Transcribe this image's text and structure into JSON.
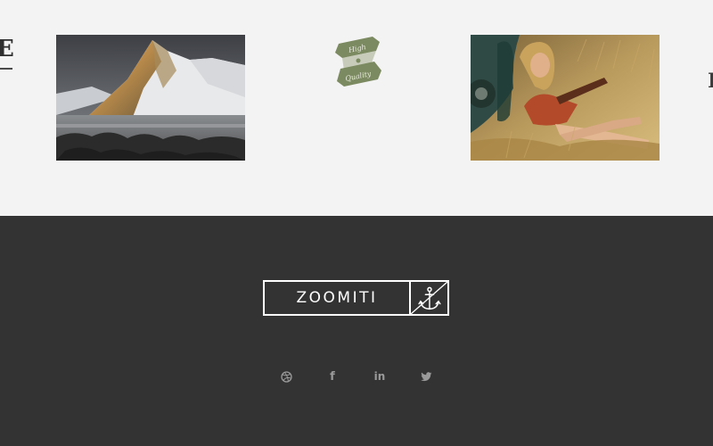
{
  "gallery": {
    "left_fragment": "E",
    "right_fragment": "I",
    "badge_line1": "High",
    "badge_line2": "Quality",
    "badge_color": "#7c8a61"
  },
  "footer": {
    "background": "#333333",
    "logo_text": "ZOOMITI",
    "logo_icon": "anchor-icon",
    "social": [
      {
        "name": "dribbble-icon",
        "glyph": "⚽"
      },
      {
        "name": "facebook-icon",
        "glyph": "f"
      },
      {
        "name": "linkedin-icon",
        "glyph": "in"
      },
      {
        "name": "twitter-icon",
        "glyph": "🐦"
      }
    ]
  }
}
